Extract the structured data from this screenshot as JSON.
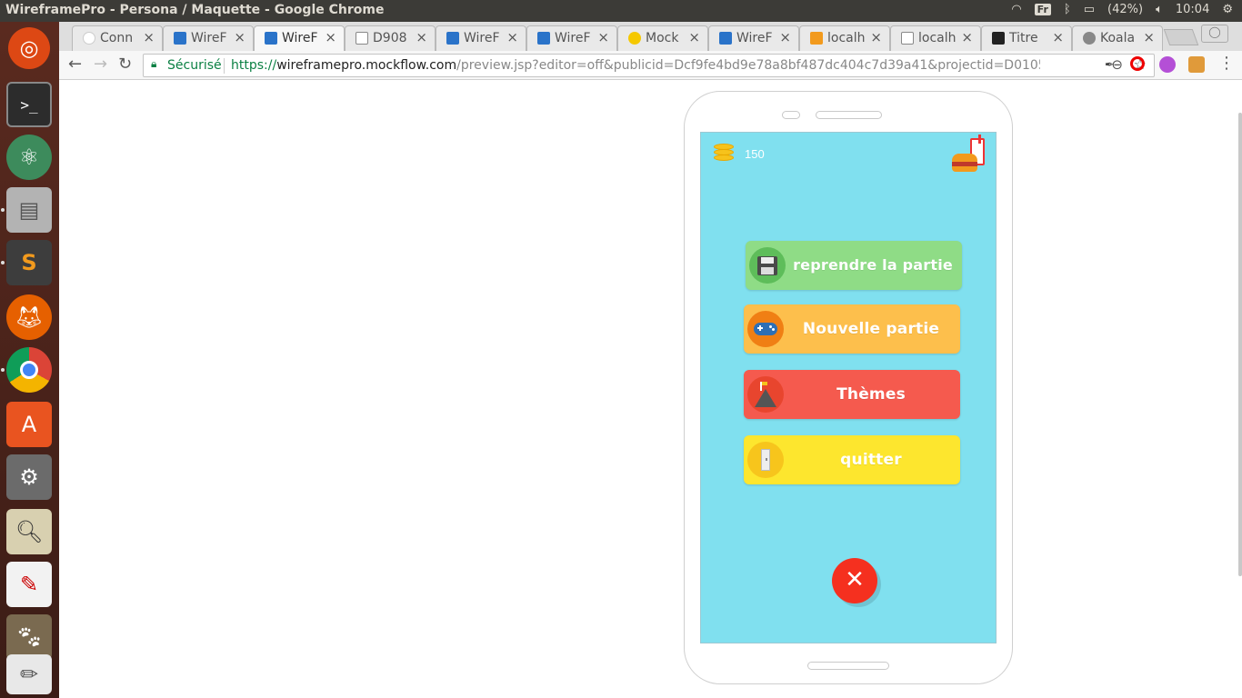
{
  "window": {
    "title": "WireframePro - Persona / Maquette - Google Chrome",
    "keyboard": "Fr",
    "battery": "(42%)",
    "clock": "10:04"
  },
  "tabs": [
    {
      "label": "Conn",
      "icon": "google-icon"
    },
    {
      "label": "WireF",
      "icon": "wireframe-icon"
    },
    {
      "label": "WireF",
      "icon": "wireframe-icon",
      "active": true
    },
    {
      "label": "D908",
      "icon": "doc-icon"
    },
    {
      "label": "WireF",
      "icon": "wireframe-icon"
    },
    {
      "label": "WireF",
      "icon": "wireframe-icon"
    },
    {
      "label": "Mock",
      "icon": "mockflow-icon"
    },
    {
      "label": "WireF",
      "icon": "wireframe-icon"
    },
    {
      "label": "localh",
      "icon": "pma-icon"
    },
    {
      "label": "localh",
      "icon": "doc-icon"
    },
    {
      "label": "Titre",
      "icon": "trello-icon"
    },
    {
      "label": "Koala",
      "icon": "koala-icon"
    }
  ],
  "omnibox": {
    "secure_label": "Sécurisé",
    "url_scheme": "https://",
    "url_host": "wireframepro.mockflow.com",
    "url_rest": "/preview.jsp?editor=off&publicid=Dcf9fe4bd9e78a8bf487dc404c7d39a41&projectid=D0105edf78a80..."
  },
  "app": {
    "coin_count": "150",
    "menu": [
      {
        "label": "reprendre la partie",
        "color": "#8fdc86",
        "icon": "floppy-disk-icon"
      },
      {
        "label": "Nouvelle partie",
        "color": "#fdbf4c",
        "icon": "gamepad-icon"
      },
      {
        "label": "Thèmes",
        "color": "#f55a4e",
        "icon": "mountain-icon"
      },
      {
        "label": "quitter",
        "color": "#fde62e",
        "icon": "exit-door-icon"
      }
    ],
    "close_icon": "close-icon",
    "screen_color": "#80e0ef"
  }
}
